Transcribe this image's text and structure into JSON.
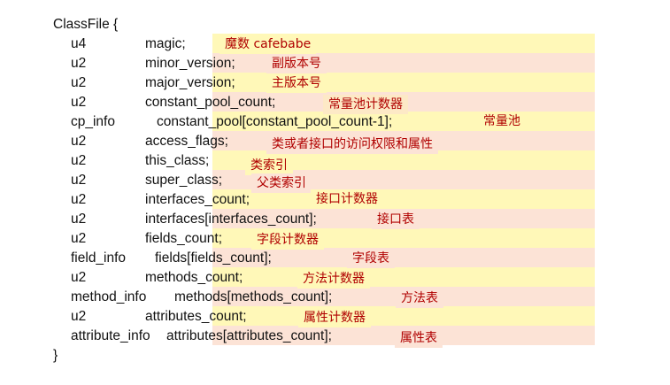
{
  "header": "ClassFile {",
  "footer": "}",
  "rows": [
    {
      "type": "u4",
      "field": "magic;",
      "note": "魔数 cafebabe"
    },
    {
      "type": "u2",
      "field": "minor_version;",
      "note": "副版本号"
    },
    {
      "type": "u2",
      "field": "major_version;",
      "note": "主版本号"
    },
    {
      "type": "u2",
      "field": "constant_pool_count;",
      "note": "常量池计数器"
    },
    {
      "type": "cp_info",
      "field": "constant_pool[constant_pool_count-1];",
      "note": "常量池"
    },
    {
      "type": "u2",
      "field": "access_flags;",
      "note": "类或者接口的访问权限和属性"
    },
    {
      "type": "u2",
      "field": "this_class;",
      "note": "类索引"
    },
    {
      "type": "u2",
      "field": "super_class;",
      "note": "父类索引"
    },
    {
      "type": "u2",
      "field": "interfaces_count;",
      "note": "接口计数器"
    },
    {
      "type": "u2",
      "field": "interfaces[interfaces_count];",
      "note": "接口表"
    },
    {
      "type": "u2",
      "field": "fields_count;",
      "note": "字段计数器"
    },
    {
      "type": "field_info",
      "field": "fields[fields_count];",
      "note": "字段表"
    },
    {
      "type": "u2",
      "field": "methods_count;",
      "note": "方法计数器"
    },
    {
      "type": "method_info",
      "field": "methods[methods_count];",
      "note": "方法表"
    },
    {
      "type": "u2",
      "field": "attributes_count;",
      "note": "属性计数器"
    },
    {
      "type": "attribute_info",
      "field": "attributes[attributes_count];",
      "note": "属性表"
    }
  ],
  "colors": {
    "note_text": "#b00000",
    "highlight_yellow": "#fff8b8",
    "highlight_pink": "#fce3d6"
  }
}
